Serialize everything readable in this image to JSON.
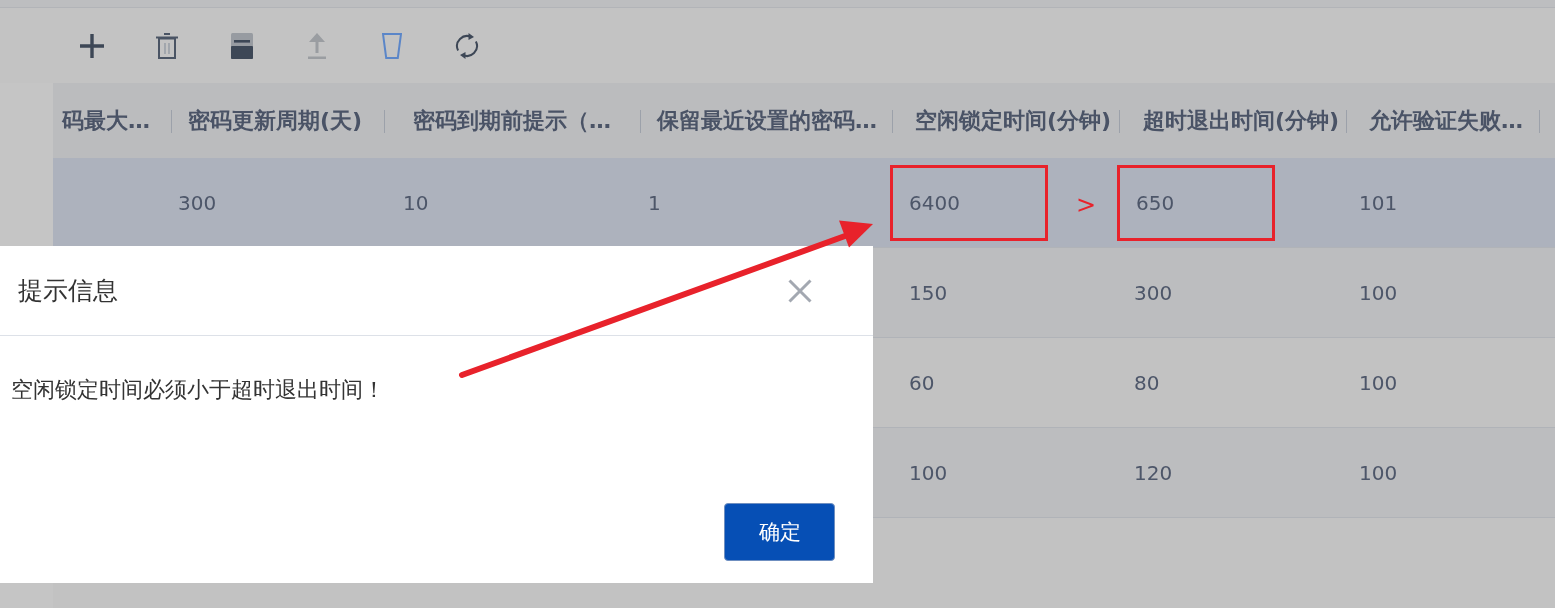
{
  "toolbar": {
    "buttons": [
      {
        "kind": "plus",
        "disabled": false
      },
      {
        "kind": "trash",
        "disabled": false
      },
      {
        "kind": "save",
        "disabled": false
      },
      {
        "kind": "upload",
        "disabled": true
      },
      {
        "kind": "cup",
        "disabled": false
      },
      {
        "kind": "refresh",
        "disabled": false
      }
    ]
  },
  "table": {
    "columns": [
      "码最大…",
      "密码更新周期(天)",
      "密码到期前提示（…",
      "保留最近设置的密码…",
      "空闲锁定时间(分钟)",
      "超时退出时间(分钟)",
      "允许验证失败…"
    ],
    "rows": [
      {
        "selected": true,
        "cells": [
          {
            "text": "",
            "highlighted": false
          },
          {
            "text": "300",
            "highlighted": false
          },
          {
            "text": "10",
            "highlighted": false
          },
          {
            "text": "1",
            "highlighted": false
          },
          {
            "text": "6400",
            "highlighted": true
          },
          {
            "text": "650",
            "highlighted": true
          },
          {
            "text": "101",
            "highlighted": false
          }
        ]
      },
      {
        "selected": false,
        "cells": [
          {
            "text": "",
            "highlighted": false
          },
          {
            "text": "",
            "highlighted": false
          },
          {
            "text": "",
            "highlighted": false
          },
          {
            "text": "",
            "highlighted": false
          },
          {
            "text": "150",
            "highlighted": false
          },
          {
            "text": "300",
            "highlighted": false
          },
          {
            "text": "100",
            "highlighted": false
          }
        ]
      },
      {
        "selected": false,
        "cells": [
          {
            "text": "",
            "highlighted": false
          },
          {
            "text": "",
            "highlighted": false
          },
          {
            "text": "",
            "highlighted": false
          },
          {
            "text": "",
            "highlighted": false
          },
          {
            "text": "60",
            "highlighted": false
          },
          {
            "text": "80",
            "highlighted": false
          },
          {
            "text": "100",
            "highlighted": false
          }
        ]
      },
      {
        "selected": false,
        "cells": [
          {
            "text": "",
            "highlighted": false
          },
          {
            "text": "",
            "highlighted": false
          },
          {
            "text": "",
            "highlighted": false
          },
          {
            "text": "",
            "highlighted": false
          },
          {
            "text": "100",
            "highlighted": false
          },
          {
            "text": "120",
            "highlighted": false
          },
          {
            "text": "100",
            "highlighted": false
          }
        ]
      }
    ]
  },
  "annotation": {
    "comparison_sign": ">"
  },
  "dialog": {
    "title": "提示信息",
    "message": "空闲锁定时间必须小于超时退出时间！",
    "buttons": [
      {
        "label": "确定"
      }
    ]
  }
}
